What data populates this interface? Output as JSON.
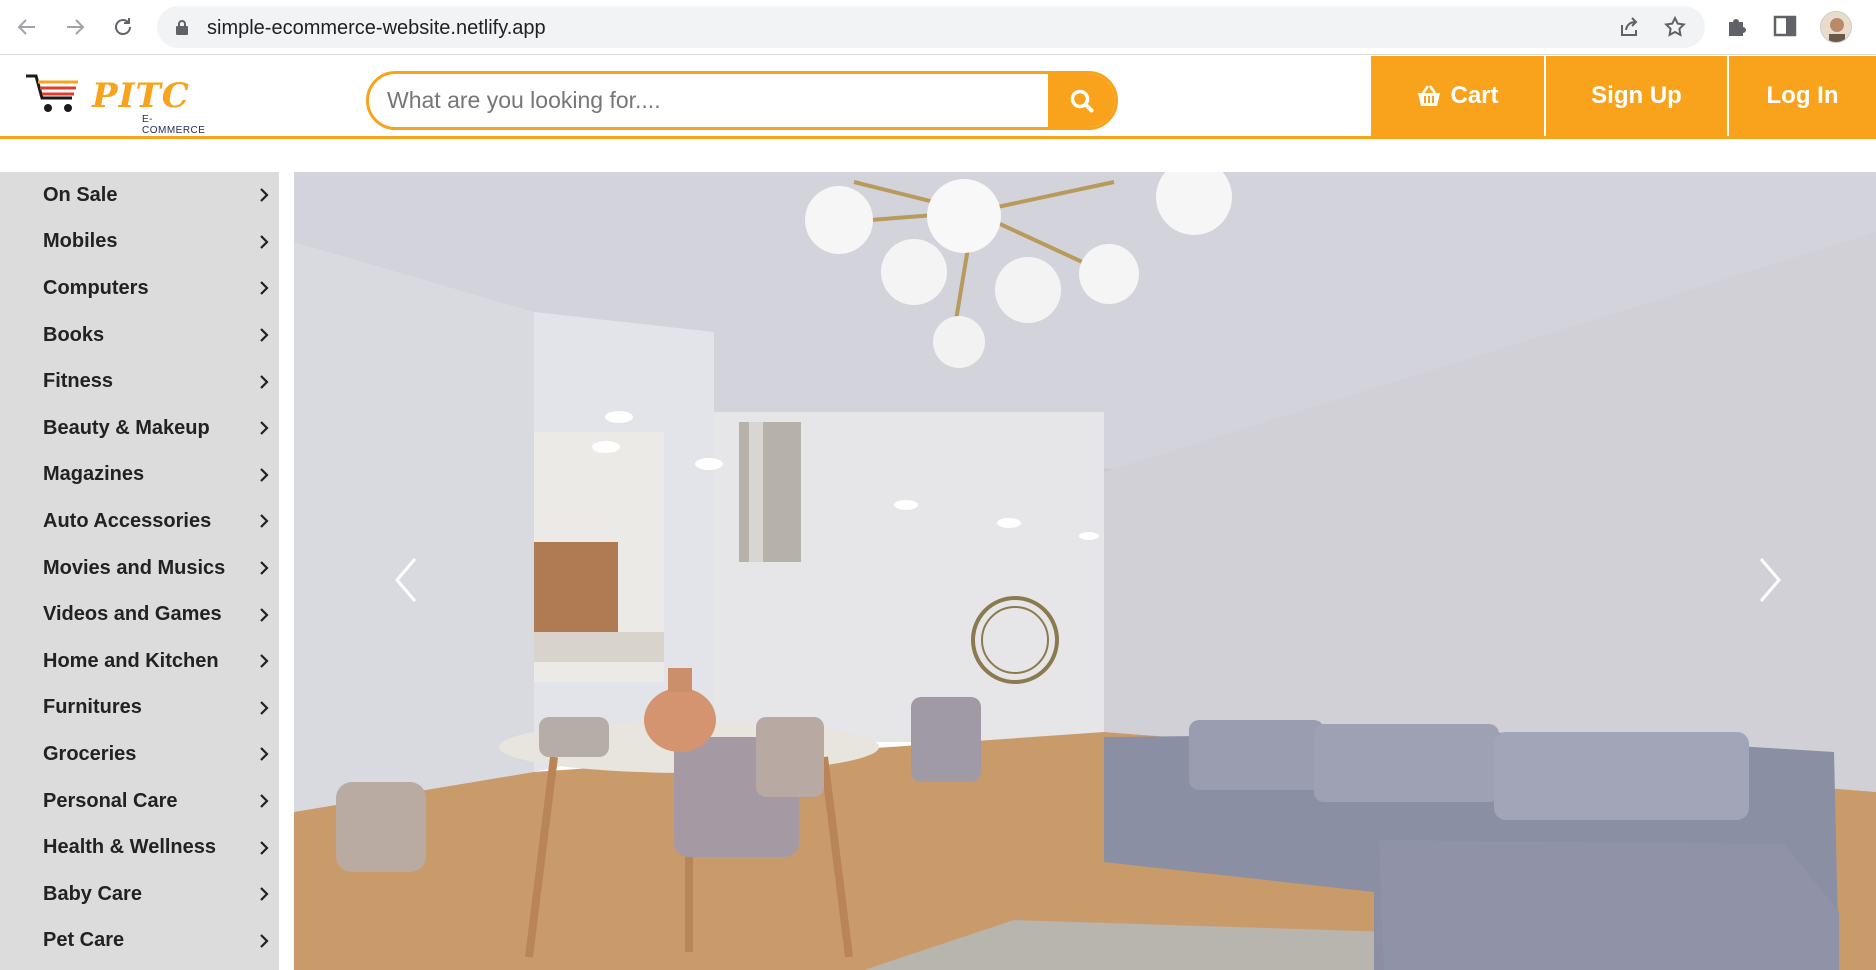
{
  "browser": {
    "url": "simple-ecommerce-website.netlify.app",
    "icons": [
      "back-icon",
      "forward-icon",
      "reload-icon",
      "lock-icon",
      "share-icon",
      "star-icon",
      "extensions-icon",
      "sidepanel-icon",
      "profile-avatar"
    ]
  },
  "header": {
    "logo_text": "PITC",
    "logo_sub": "E-COMMERCE",
    "search_placeholder": "What are you looking for....",
    "cart_label": "Cart",
    "signup_label": "Sign Up",
    "login_label": "Log In",
    "accent_color": "#f9a21b"
  },
  "sidebar": {
    "items": [
      {
        "label": "On Sale"
      },
      {
        "label": "Mobiles"
      },
      {
        "label": "Computers"
      },
      {
        "label": "Books"
      },
      {
        "label": "Fitness"
      },
      {
        "label": "Beauty & Makeup"
      },
      {
        "label": "Magazines"
      },
      {
        "label": "Auto Accessories"
      },
      {
        "label": "Movies and Musics"
      },
      {
        "label": "Videos and Games"
      },
      {
        "label": "Home and Kitchen"
      },
      {
        "label": "Furnitures"
      },
      {
        "label": "Groceries"
      },
      {
        "label": "Personal Care"
      },
      {
        "label": "Health & Wellness"
      },
      {
        "label": "Baby Care"
      },
      {
        "label": "Pet Care"
      }
    ]
  },
  "carousel": {
    "slide_description_icon": "living-room-image",
    "prev_icon": "chevron-left-icon",
    "next_icon": "chevron-right-icon"
  }
}
